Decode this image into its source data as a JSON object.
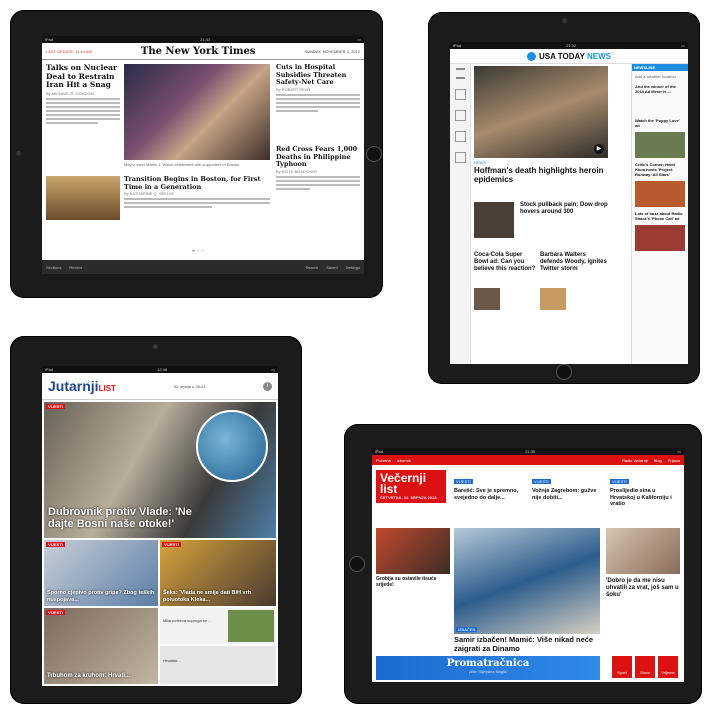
{
  "nyt": {
    "status_left": "iPad",
    "status_time": "21:32",
    "last_update": "LAST UPDATE: 11:14 AM",
    "logo": "The New York Times",
    "date": "SUNDAY, NOVEMBER 4, 2012",
    "story1_title": "Talks on Nuclear Deal to Restrain Iran Hit a Snag",
    "story1_byline": "By MICHAEL R. GORDON",
    "story2_title": "Cuts in Hospital Subsidies Threaten Safety-Net Care",
    "story2_byline": "By ROBERT PEAR",
    "story3_title": "Transition Begins in Boston, for First Time in a Generation",
    "story3_byline": "By KATHARINE Q. SEELYE",
    "story4_title": "Red Cross Fears 1,000 Deaths in Philippine Typhoon",
    "story4_byline": "By KEITH BRADSHER",
    "photo_caption": "Mayor-elect Martin J. Walsh celebrated with supporters in Boston.",
    "toolbar_left": [
      "Sections",
      "Recent"
    ],
    "toolbar_right": [
      "Search",
      "Saved",
      "Settings"
    ]
  },
  "usa": {
    "status_left": "iPad",
    "status_time": "21:32",
    "brand_a": "USA TODAY",
    "brand_b": "NEWS",
    "newsline": "NEWSLINE",
    "add_weather": "Add a weather location",
    "main_headline": "Hoffman's death highlights heroin epidemics",
    "news_label": "NEWS",
    "story_stock": "Stock pullback pain: Dow drop hovers around 300",
    "story_coke": "Coca-Cola Super Bowl ad: Can you believe this reaction?",
    "story_walters": "Barbara Walters defends Woody, ignites Twitter storm",
    "rail_items": [
      "And the winner of the 2014 Ad Meter is ...",
      "Watch the 'Puppy Love' ad",
      "Critic's Corner: Heidi Klum hosts 'Project Runway: All Stars'",
      "Lots of buzz about Radio Shack's 'Phone Call' ad"
    ]
  },
  "jut": {
    "logo_a": "Jutarnji",
    "logo_b": "LIST",
    "date": "30. srpnja u 23:24",
    "tag": "VIJESTI",
    "main_headline": "Dubrovnik protiv Vlade: 'Ne dajte Bosni naše otoke!'",
    "tile1": "Sporno cjepivo protiv gripe? Zbog teških nuspojava...",
    "tile2": "Šeks: 'Vlada ne smije dati BiH vrh poluotoka Kleka...",
    "tile3": "Trbuhom za kruhom: Hrvati...",
    "tile4": "Milanovićeva supruga ne...",
    "tile5": "Hrvatski...",
    "tile_label": "VIJESTI"
  },
  "vec": {
    "status_left": "iPad",
    "status_time": "21:35",
    "topbar_left": [
      "Početna",
      "Izbornik"
    ],
    "topbar_right": [
      "Radio Večernji",
      "Blog",
      "Prijava"
    ],
    "logo_a": "Večernji",
    "logo_b": "list",
    "logo_date": "ČETVRTAK, 31. SRPNJA 2013.",
    "tag_vijesti": "VIJESTI",
    "story1": "Baretić: Sve je spremno, svejedno do dalje...",
    "story2": "Vožnja Zagrebom: gužve nije dobiti...",
    "story3": "Proslijedio sina u Hrvatskoj u Kaliforniju i vratio",
    "main_headline": "Samir izbačen! Mamić: Više nikad neće zaigrati za Dinamo",
    "main_tag": "IZBAČEN",
    "side_quote": "'Dobro je da me nisu uhvatili za vrat, još sam u šoku'",
    "left_story": "Grobija su ostavile tisuće srijede!",
    "banner": "Promatračnica",
    "banner_sub": "piše: Stjepana Naglić",
    "bottom_icons": [
      "Sport",
      "Show",
      "Vrijeme"
    ]
  }
}
